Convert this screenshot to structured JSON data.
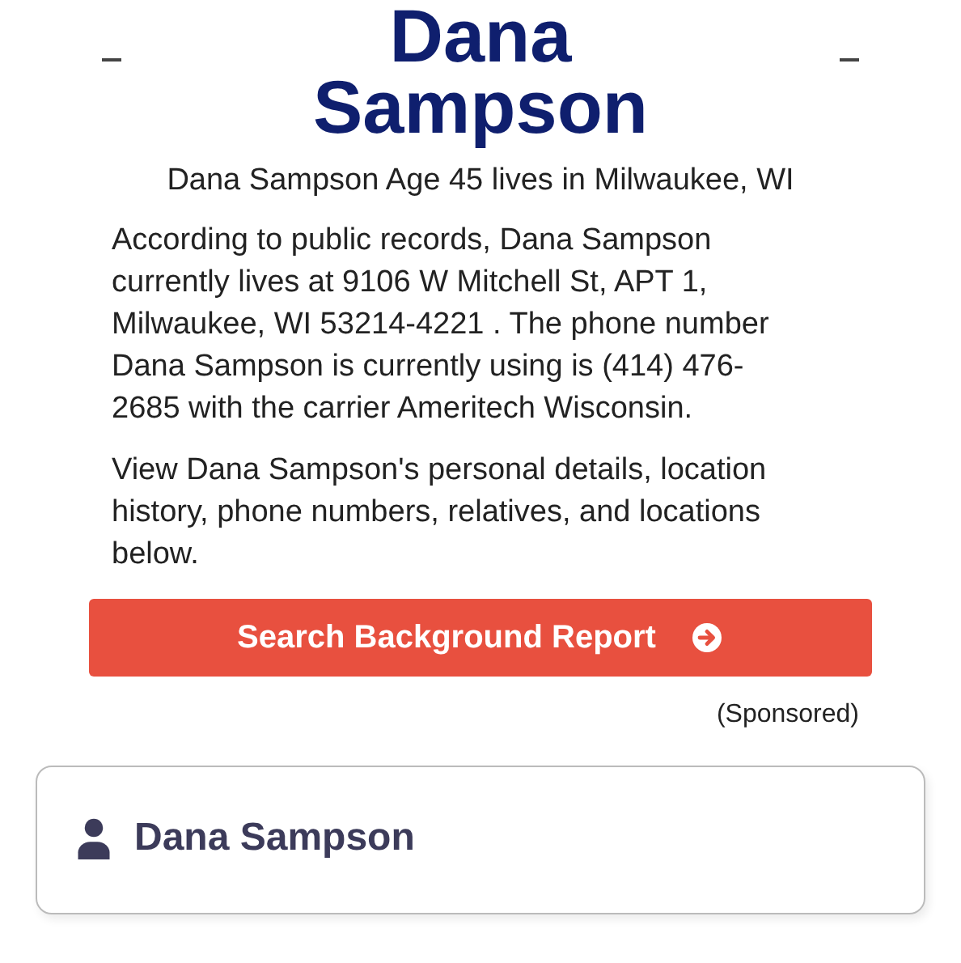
{
  "heading": "Dana Sampson",
  "summary": "Dana Sampson Age 45 lives in Milwaukee, WI",
  "paragraphs": [
    "According to public records, Dana Sampson currently lives at 9106 W Mitchell St, APT 1, Milwaukee, WI 53214-4221 . The phone number Dana Sampson is currently using is (414) 476-2685 with the carrier Ameritech Wisconsin.",
    "View Dana Sampson's personal details, location history, phone numbers, relatives, and locations below."
  ],
  "button": {
    "label": "Search Background Report"
  },
  "sponsored": "(Sponsored)",
  "card": {
    "name": "Dana Sampson"
  }
}
